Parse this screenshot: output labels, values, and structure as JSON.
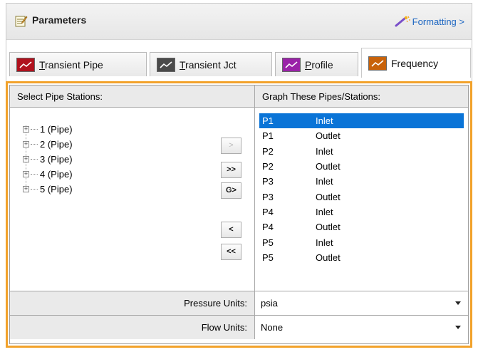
{
  "header": {
    "title": "Parameters",
    "formatting_link": "Formatting >",
    "icon": "parameters-icon",
    "link_icon": "wand-icon"
  },
  "tabs": [
    {
      "label": "Transient Pipe",
      "mnemonic": "T",
      "rest": "ransient Pipe",
      "icon_color": "#b0121e"
    },
    {
      "label": "Transient Jct",
      "mnemonic": "T",
      "rest": "ransient Jct",
      "icon_color": "#4a4a4a"
    },
    {
      "label": "Profile",
      "mnemonic": "P",
      "rest": "rofile",
      "icon_color": "#9a22a8"
    },
    {
      "label": "Frequency",
      "mnemonic": "",
      "rest": "Frequency",
      "icon_color": "#c8620a"
    }
  ],
  "left_panel": {
    "title": "Select Pipe Stations:",
    "tree": [
      "1 (Pipe)",
      "2 (Pipe)",
      "3 (Pipe)",
      "4 (Pipe)",
      "5 (Pipe)"
    ]
  },
  "buttons": {
    "add": ">",
    "add_all": ">>",
    "graph": "G>",
    "remove": "<",
    "remove_all": "<<"
  },
  "right_panel": {
    "title": "Graph These Pipes/Stations:",
    "items": [
      {
        "pipe": "P1",
        "station": "Inlet"
      },
      {
        "pipe": "P1",
        "station": "Outlet"
      },
      {
        "pipe": "P2",
        "station": "Inlet"
      },
      {
        "pipe": "P2",
        "station": "Outlet"
      },
      {
        "pipe": "P3",
        "station": "Inlet"
      },
      {
        "pipe": "P3",
        "station": "Outlet"
      },
      {
        "pipe": "P4",
        "station": "Inlet"
      },
      {
        "pipe": "P4",
        "station": "Outlet"
      },
      {
        "pipe": "P5",
        "station": "Inlet"
      },
      {
        "pipe": "P5",
        "station": "Outlet"
      }
    ]
  },
  "pressure": {
    "label": "Pressure Units:",
    "value": "psia"
  },
  "flow": {
    "label": "Flow Units:",
    "value": "None"
  },
  "colors": {
    "accent": "#f2a22b",
    "selection": "#0a74d7",
    "link": "#1b65c1"
  }
}
